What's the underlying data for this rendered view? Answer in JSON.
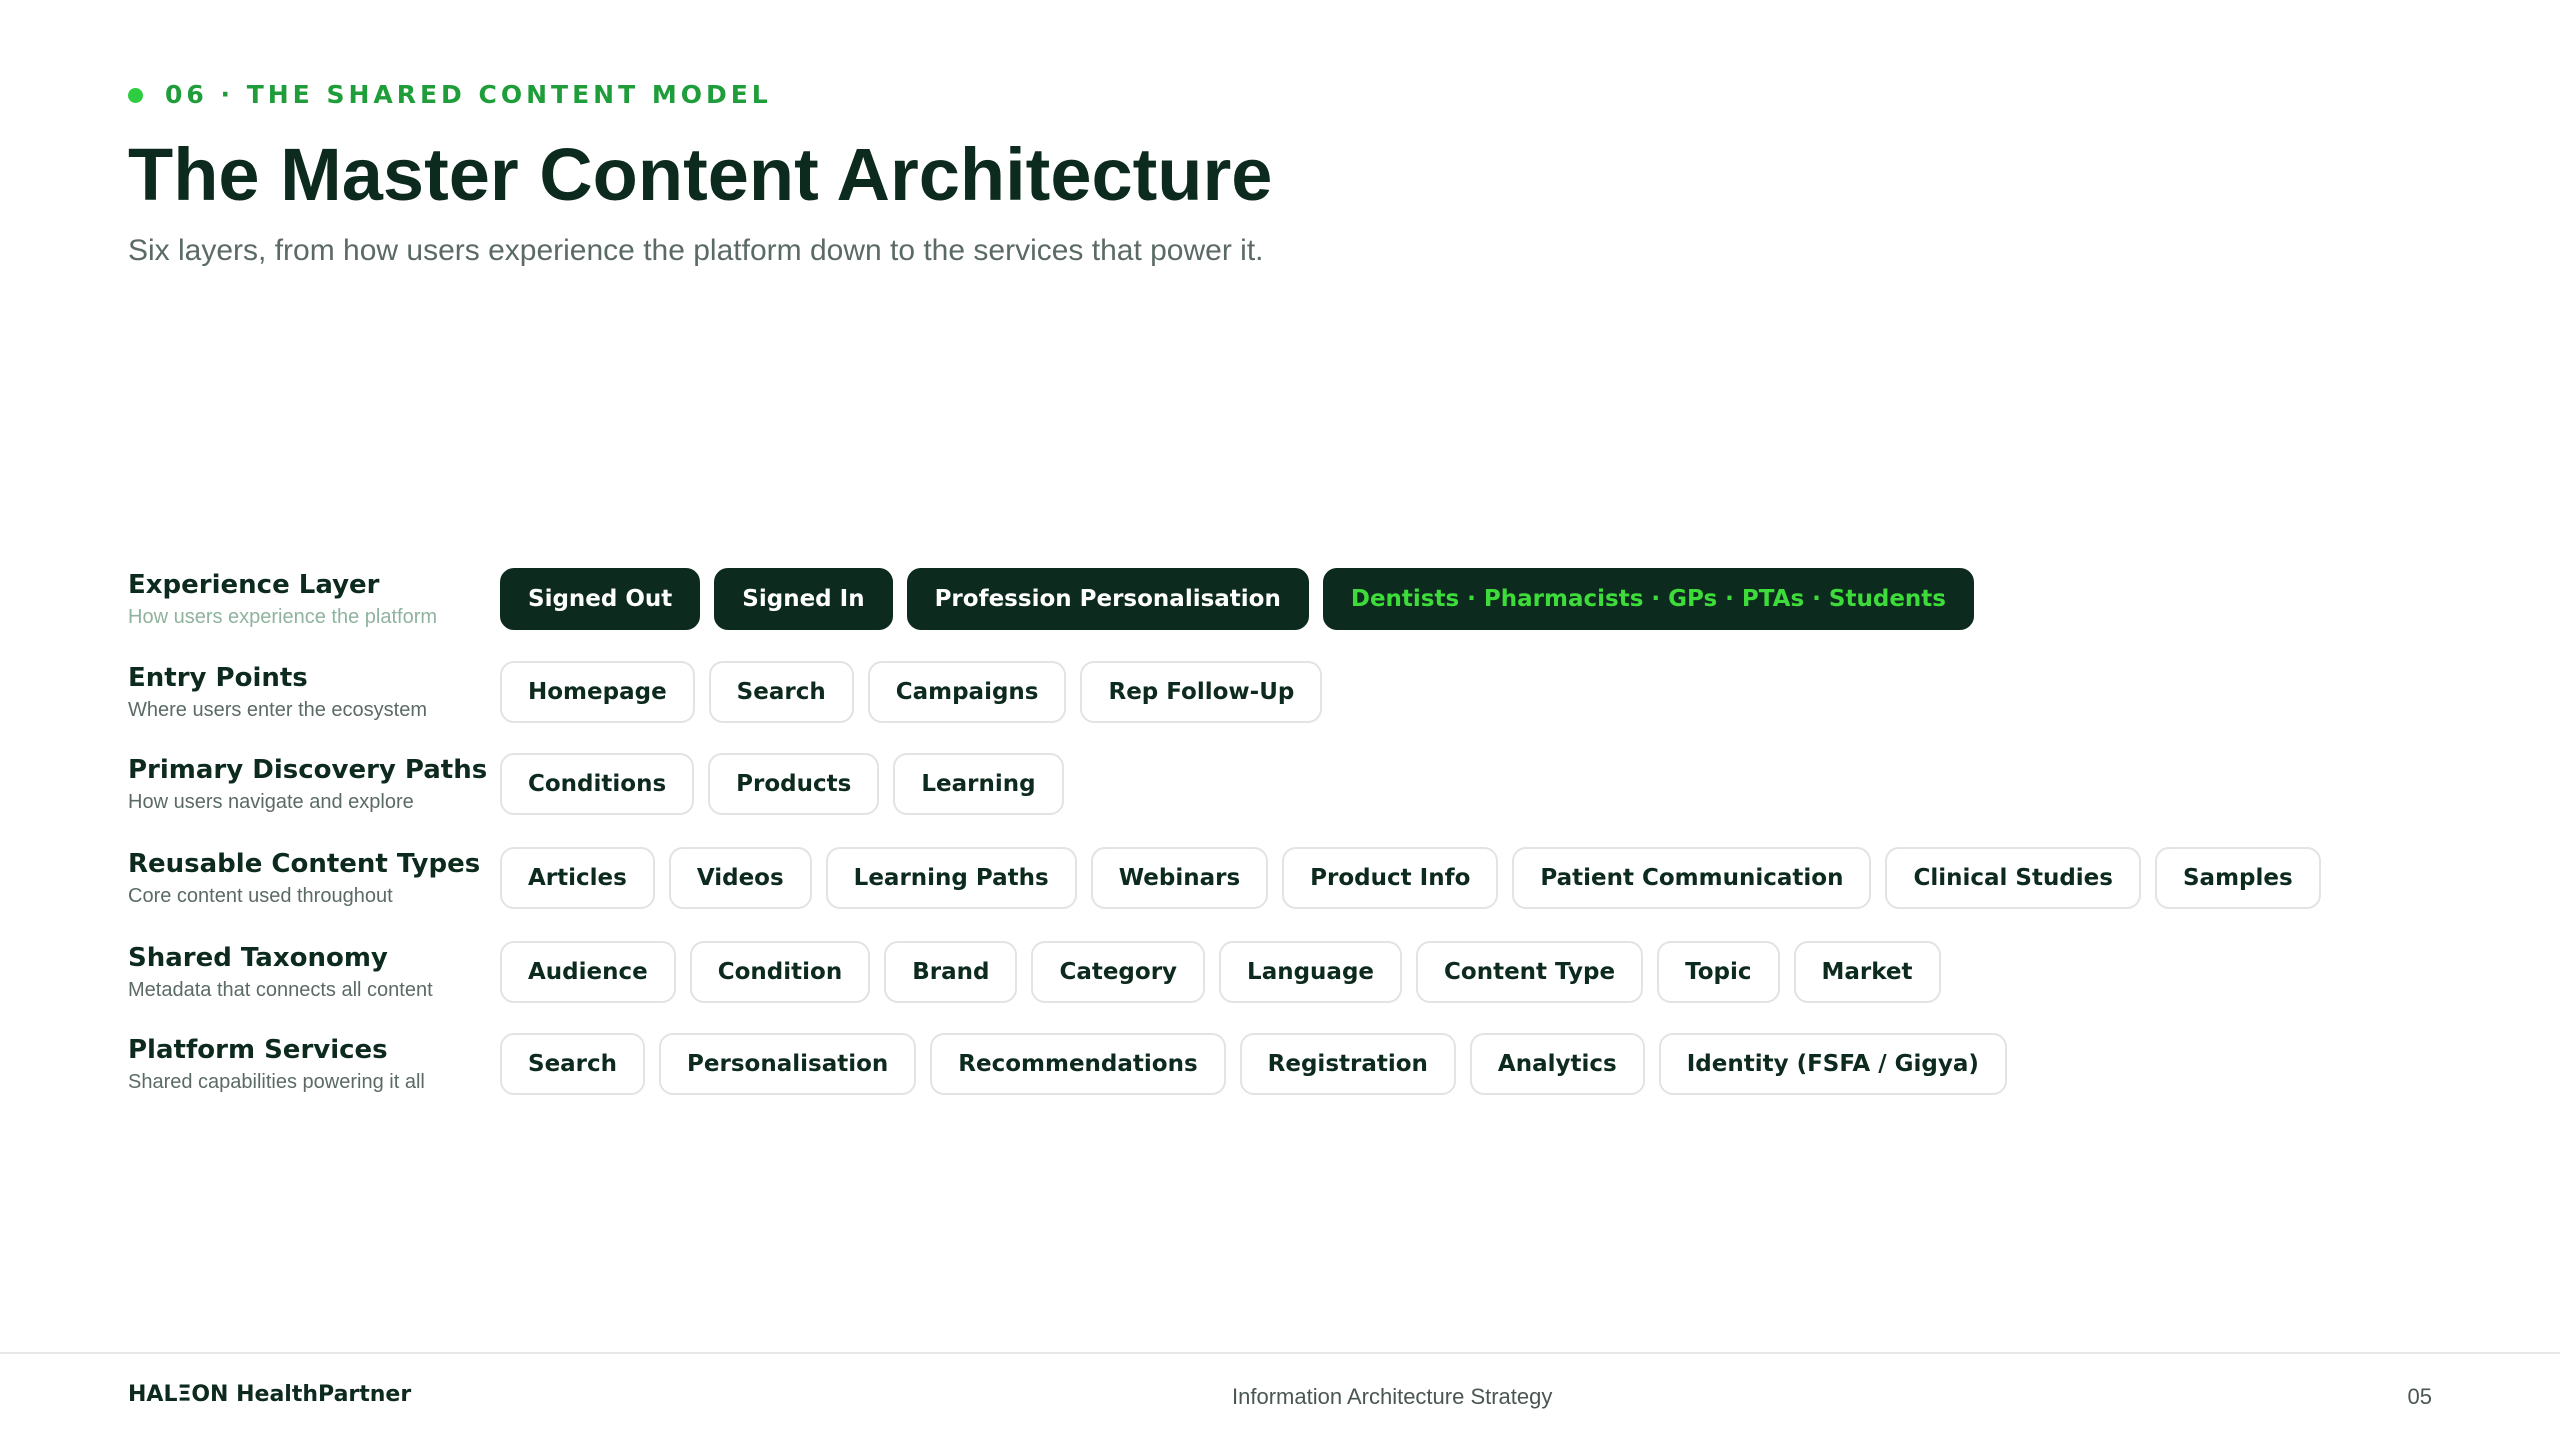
{
  "eyebrow": "06 · THE SHARED CONTENT MODEL",
  "title": "The Master Content Architecture",
  "subtitle": "Six layers, from how users experience the platform down to the services that power it.",
  "layers": [
    {
      "title": "Experience Layer",
      "description": "How users experience the platform",
      "chips": [
        "Signed Out",
        "Signed In",
        "Profession Personalisation",
        "Dentists · Pharmacists · GPs · PTAs · Students"
      ]
    },
    {
      "title": "Entry Points",
      "description": "Where users enter the ecosystem",
      "chips": [
        "Homepage",
        "Search",
        "Campaigns",
        "Rep Follow-Up"
      ]
    },
    {
      "title": "Primary Discovery Paths",
      "description": "How users navigate and explore",
      "chips": [
        "Conditions",
        "Products",
        "Learning"
      ]
    },
    {
      "title": "Reusable Content Types",
      "description": "Core content used throughout",
      "chips": [
        "Articles",
        "Videos",
        "Learning Paths",
        "Webinars",
        "Product Info",
        "Patient Communication",
        "Clinical Studies",
        "Samples"
      ]
    },
    {
      "title": "Shared Taxonomy",
      "description": "Metadata that connects all content",
      "chips": [
        "Audience",
        "Condition",
        "Brand",
        "Category",
        "Language",
        "Content Type",
        "Topic",
        "Market"
      ]
    },
    {
      "title": "Platform Services",
      "description": "Shared capabilities powering it all",
      "chips": [
        "Search",
        "Personalisation",
        "Recommendations",
        "Registration",
        "Analytics",
        "Identity (FSFA / Gigya)"
      ]
    }
  ],
  "footer": {
    "brand": "HALΞON HealthPartner",
    "center": "Information Architecture Strategy",
    "page": "05"
  },
  "colors": {
    "accent_green": "#1f9d3a",
    "dark_green": "#0d2a1e",
    "highlight_green": "#3ddc3a"
  }
}
